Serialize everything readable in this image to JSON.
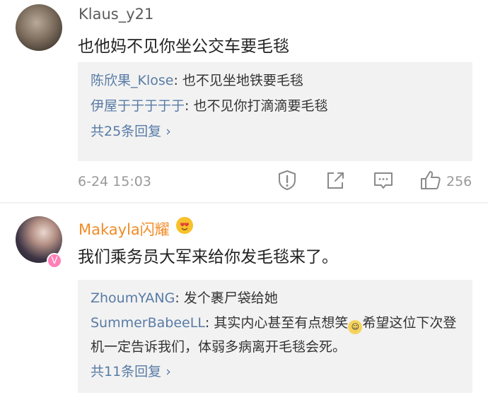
{
  "comments": [
    {
      "username": "Klaus_y21",
      "content": "也他妈不见你坐公交车要毛毯",
      "replies": [
        {
          "user": "陈欣果_Klose",
          "text": ": 也不见坐地铁要毛毯"
        },
        {
          "user": "伊屋于于于于于",
          "text": ": 也不见你打滴滴要毛毯"
        }
      ],
      "more_label": "共25条回复",
      "timestamp": "6-24 15:03",
      "like_count": "256"
    },
    {
      "username": "Makayla闪耀",
      "content": "我们乘务员大军来给你发毛毯来了。",
      "replies": [
        {
          "user": "ZhoumYANG",
          "text": ": 发个裹尸袋给她"
        },
        {
          "user": "SummerBabeeLL",
          "text": ": 其实内心甚至有点想笑",
          "text2": "希望这位下次登机一定告诉我们，体弱多病离开毛毯会死。"
        }
      ],
      "more_label": "共11条回复"
    }
  ],
  "icons": {
    "chevron": "›",
    "verified_badge": "V",
    "emoji": "☺"
  },
  "colors": {
    "reply_user": "#587ba5",
    "vip_username": "#f18b26",
    "reply_bg": "#f2f2f2"
  }
}
